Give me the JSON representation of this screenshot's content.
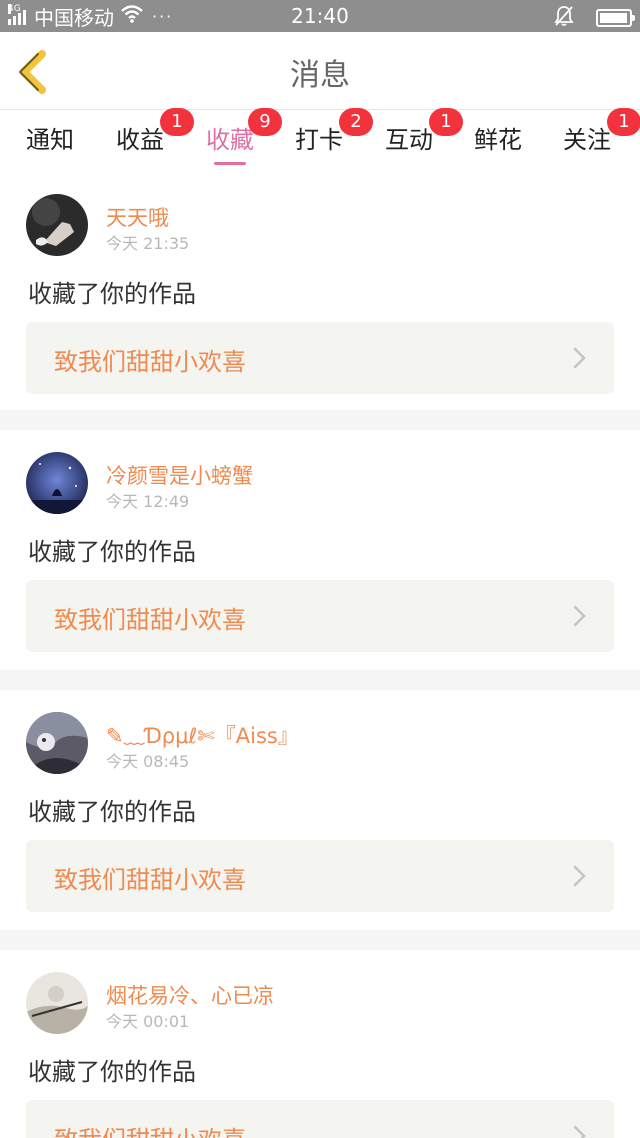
{
  "status_bar": {
    "network": "4G",
    "carrier": "中国移动",
    "dots": "···",
    "time": "21:40",
    "icons": [
      "signal-icon",
      "wifi-icon",
      "mute-icon",
      "battery-icon"
    ],
    "battery_level": 0.95
  },
  "header": {
    "title": "消息",
    "back_icon": "back-chevron-icon"
  },
  "tabs": [
    {
      "label": "通知",
      "badge": ""
    },
    {
      "label": "收益",
      "badge": "1"
    },
    {
      "label": "收藏",
      "badge": "9",
      "active": true
    },
    {
      "label": "打卡",
      "badge": "2"
    },
    {
      "label": "互动",
      "badge": "1"
    },
    {
      "label": "鲜花",
      "badge": ""
    },
    {
      "label": "关注",
      "badge": "1"
    }
  ],
  "notifications": [
    {
      "user": "天天哦",
      "time": "今天 21:35",
      "action": "收藏了你的作品",
      "work": "致我们甜甜小欢喜"
    },
    {
      "user": "冷颜雪是小螃蟹",
      "time": "今天 12:49",
      "action": "收藏了你的作品",
      "work": "致我们甜甜小欢喜"
    },
    {
      "user": "✎﹏Ɗρμℓ✄『Aiss』",
      "time": "今天 08:45",
      "action": "收藏了你的作品",
      "work": "致我们甜甜小欢喜"
    },
    {
      "user": "烟花易冷、心已凉",
      "time": "今天 00:01",
      "action": "收藏了你的作品",
      "work": "致我们甜甜小欢喜"
    }
  ],
  "colors": {
    "accent_pink": "#e06fa5",
    "badge_red": "#f2333d",
    "username_orange": "#f08a4f",
    "status_bar_gray": "#8e8e8e"
  }
}
